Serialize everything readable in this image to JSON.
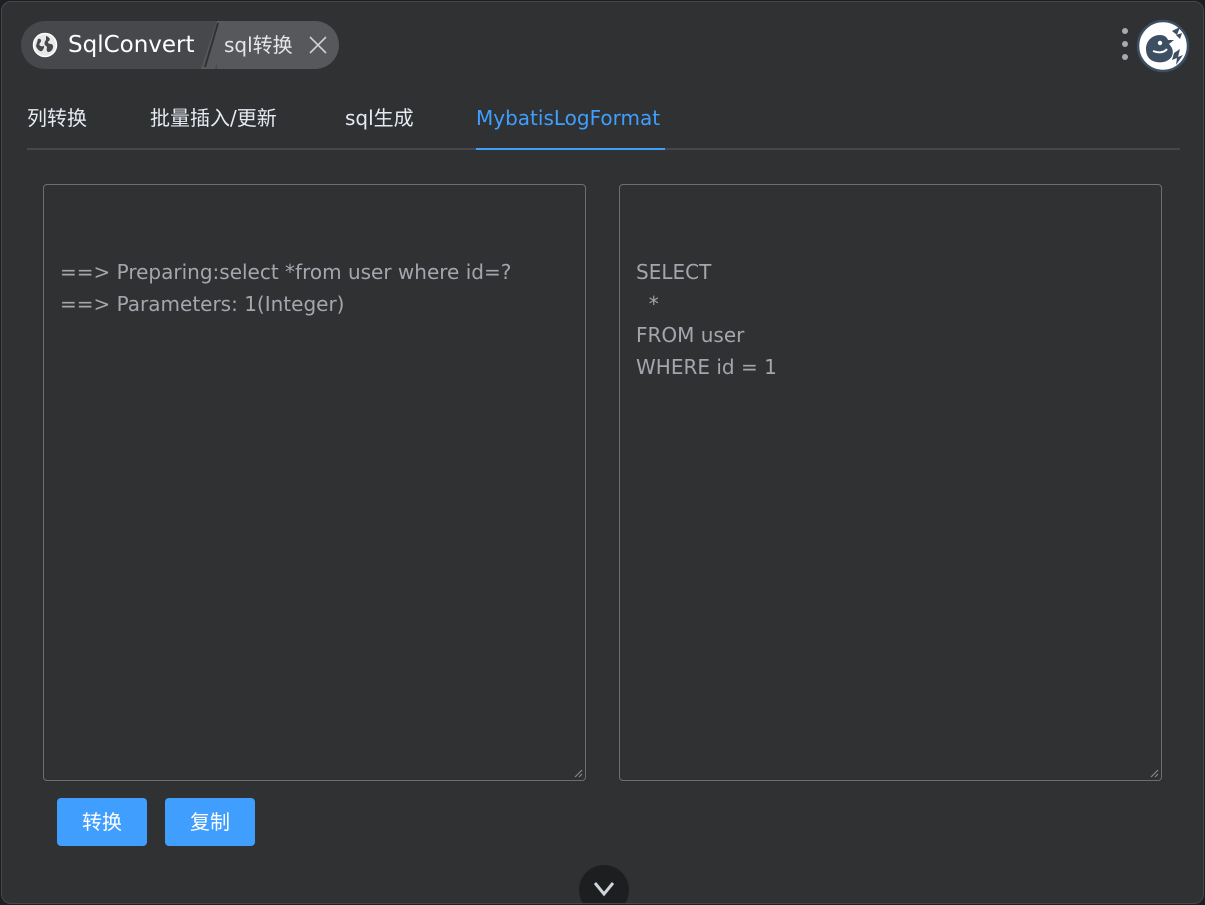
{
  "header": {
    "app_title": "SqlConvert",
    "sub_title": "sql转换",
    "icons": {
      "app": "globe-icon",
      "close": "close-icon",
      "menu": "more-vertical-icon",
      "avatar": "bird-avatar-icon",
      "collapse": "chevron-down-icon"
    }
  },
  "tabs": [
    {
      "label": "列转换",
      "active": false
    },
    {
      "label": "批量插入/更新",
      "active": false
    },
    {
      "label": "sql生成",
      "active": false
    },
    {
      "label": "MybatisLogFormat",
      "active": true
    }
  ],
  "input": {
    "value": "==> Preparing:select *from user where id=?\n==> Parameters: 1(Integer)"
  },
  "output": {
    "value": "SELECT\n  *\nFROM user\nWHERE id = 1"
  },
  "actions": {
    "convert_label": "转换",
    "copy_label": "复制"
  },
  "colors": {
    "accent": "#409eff",
    "background": "#303133",
    "text_muted": "#a3a6ad"
  }
}
